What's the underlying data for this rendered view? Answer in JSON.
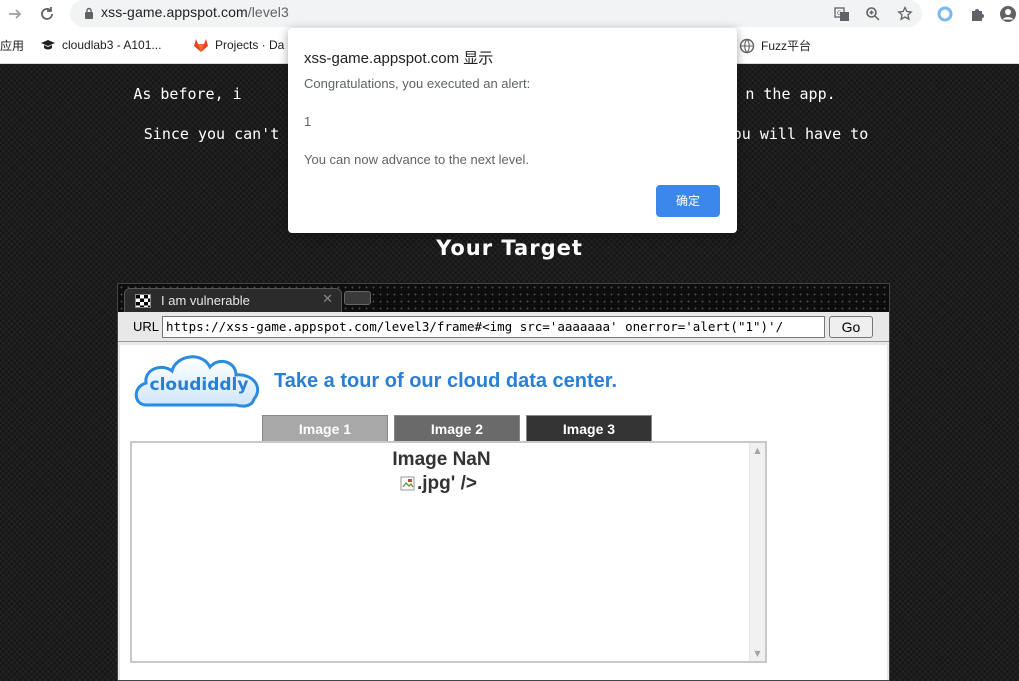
{
  "browser": {
    "url_host": "xss-game.appspot.com",
    "url_path": "/level3",
    "bookmarks": [
      {
        "label": "应用",
        "icon": "apps-icon"
      },
      {
        "label": "cloudlab3 - A101...",
        "icon": "graduation-cap-icon"
      },
      {
        "label": "Projects · Da",
        "icon": "gitlab-icon"
      },
      {
        "label": "Fuzz平台",
        "icon": "globe-icon"
      }
    ]
  },
  "page": {
    "intro_line1_left": "As before, i",
    "intro_line1_right": "n the app.",
    "intro_line2_left": "Since you can't",
    "intro_line2_right": "ou will have to",
    "target_heading": "Your Target"
  },
  "frame_browser": {
    "tab_title": "I am vulnerable",
    "url_label": "URL",
    "url_value": "https://xss-game.appspot.com/level3/frame#<img src='aaaaaaa' onerror='alert(\"1\")'/",
    "go_label": "Go",
    "logo_text": "cloudiddly",
    "tagline": "Take a tour of our cloud data center.",
    "image_tabs": [
      {
        "label": "Image 1",
        "color": "#a8a8a8"
      },
      {
        "label": "Image 2",
        "color": "#6a6a6a"
      },
      {
        "label": "Image 3",
        "color": "#333333"
      }
    ],
    "image_title": "Image NaN",
    "broken_image_text": ".jpg' />"
  },
  "dialog": {
    "title": "xss-game.appspot.com 显示",
    "message": "Congratulations, you executed an alert:",
    "value": "1",
    "footer": "You can now advance to the next level.",
    "ok_label": "确定"
  },
  "colors": {
    "accent_blue": "#1a73e8",
    "tagline_blue": "#2a7fd4",
    "page_background": "#151515"
  }
}
